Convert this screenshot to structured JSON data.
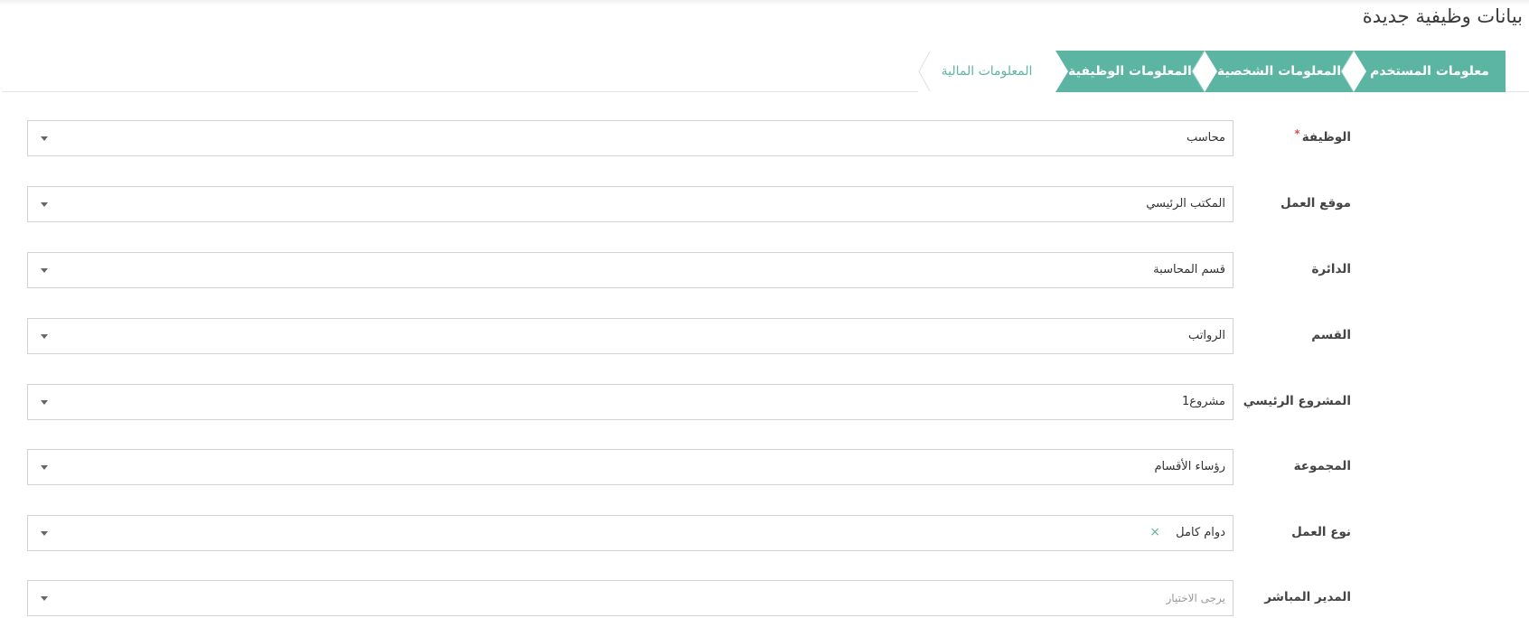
{
  "page": {
    "title": "بيانات وظيفية جديدة"
  },
  "colors": {
    "accent": "#5cb5a2",
    "required": "#d9534f"
  },
  "wizard": {
    "steps": [
      {
        "label": "معلومات المستخدم",
        "state": "active"
      },
      {
        "label": "المعلومات الشخصية",
        "state": "active"
      },
      {
        "label": "المعلومات الوظيفية",
        "state": "active"
      },
      {
        "label": "المعلومات المالية",
        "state": "inactive"
      }
    ]
  },
  "form": {
    "fields": [
      {
        "label": "الوظيفة",
        "required": "*",
        "value": "محاسب"
      },
      {
        "label": "موقع العمل",
        "value": "المكتب الرئيسي"
      },
      {
        "label": "الدائرة",
        "value": "قسم المحاسبة"
      },
      {
        "label": "القسم",
        "value": "الرواتب"
      },
      {
        "label": "المشروع الرئيسي",
        "value": "مشروع1"
      },
      {
        "label": "المجموعة",
        "value": "رؤساء الأقسام"
      },
      {
        "label": "نوع العمل",
        "value": "دوام كامل",
        "clear": "×"
      },
      {
        "label": "المدير المباشر",
        "placeholder": "يرجى الاختيار"
      }
    ]
  }
}
